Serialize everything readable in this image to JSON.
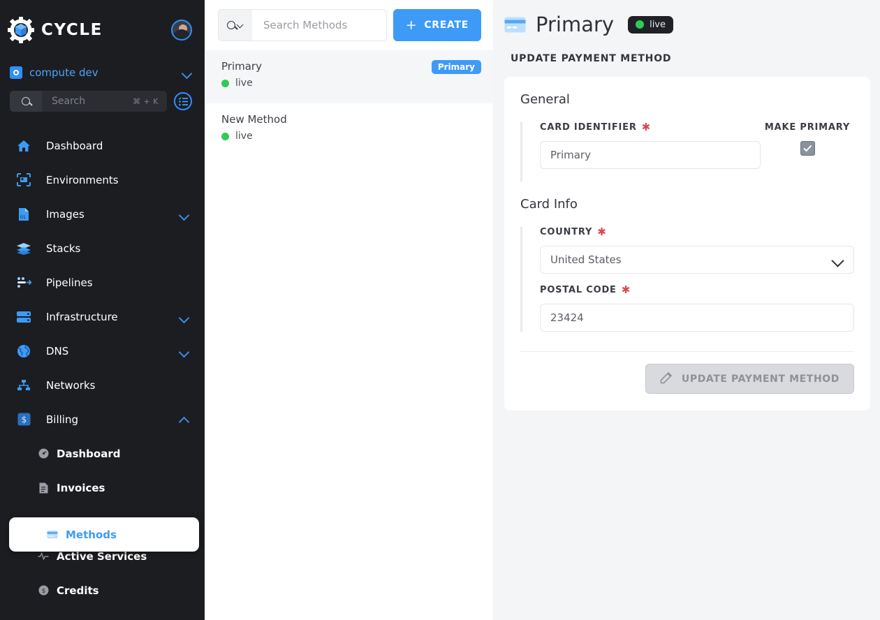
{
  "sidebar": {
    "brand": {
      "name": "CYCLE",
      "logo_icon": "cycle-gear-cube-logo",
      "avatar_icon": "user-avatar"
    },
    "context": {
      "label": "compute dev",
      "icon": "folder-gear-icon",
      "chevron": "chevron-down-icon"
    },
    "search": {
      "placeholder": "Search",
      "shortcut": "⌘ + K",
      "icon": "search-icon",
      "list_icon": "task-list-icon"
    },
    "nav": [
      {
        "label": "Dashboard",
        "icon": "home-icon",
        "expandable": false
      },
      {
        "label": "Environments",
        "icon": "environments-icon",
        "expandable": false
      },
      {
        "label": "Images",
        "icon": "image-file-icon",
        "expandable": true
      },
      {
        "label": "Stacks",
        "icon": "stacks-layers-icon",
        "expandable": false
      },
      {
        "label": "Pipelines",
        "icon": "pipelines-icon",
        "expandable": false
      },
      {
        "label": "Infrastructure",
        "icon": "server-rack-icon",
        "expandable": true
      },
      {
        "label": "DNS",
        "icon": "globe-icon",
        "expandable": true
      },
      {
        "label": "Networks",
        "icon": "network-nodes-icon",
        "expandable": false
      },
      {
        "label": "Billing",
        "icon": "dollar-badge-icon",
        "expandable": true,
        "expanded": true
      }
    ],
    "billing_sub": [
      {
        "label": "Dashboard",
        "icon": "gauge-icon",
        "active": false
      },
      {
        "label": "Invoices",
        "icon": "invoice-doc-icon",
        "active": false
      },
      {
        "label": "Methods",
        "icon": "credit-card-icon",
        "active": true
      },
      {
        "label": "Active Services",
        "icon": "pulse-icon",
        "active": false
      },
      {
        "label": "Credits",
        "icon": "coin-icon",
        "active": false
      }
    ]
  },
  "midcol": {
    "search_placeholder": "Search Methods",
    "search_icon": "search-icon",
    "search_filter_icon": "chevron-down-icon",
    "create_label": "CREATE",
    "create_icon": "plus-icon",
    "methods": [
      {
        "name": "Primary",
        "status": "live",
        "badge": "Primary",
        "selected": true
      },
      {
        "name": "New Method",
        "status": "live",
        "badge": "",
        "selected": false
      }
    ]
  },
  "detail": {
    "icon": "credit-card-icon",
    "title": "Primary",
    "status_badge": "live",
    "section_heading": "UPDATE PAYMENT METHOD",
    "general": {
      "title": "General",
      "card_identifier_label": "CARD IDENTIFIER",
      "card_identifier_value": "Primary",
      "make_primary_label": "MAKE PRIMARY",
      "make_primary_checked": true,
      "check_icon": "checkmark-icon"
    },
    "card_info": {
      "title": "Card Info",
      "country_label": "COUNTRY",
      "country_value": "United States",
      "country_chevron": "chevron-down-icon",
      "postal_label": "POSTAL CODE",
      "postal_value": "23424"
    },
    "submit": {
      "label": "UPDATE PAYMENT METHOD",
      "icon": "edit-pencil-icon",
      "disabled": true
    }
  },
  "colors": {
    "sidebar_bg": "#1c1d21",
    "accent_blue": "#3d9bf7",
    "link_blue": "#4da3ff",
    "status_green": "#2ecc57",
    "panel_bg": "#f4f5f7",
    "required_red": "#d84a52",
    "disabled_gray": "#d9dadd"
  }
}
